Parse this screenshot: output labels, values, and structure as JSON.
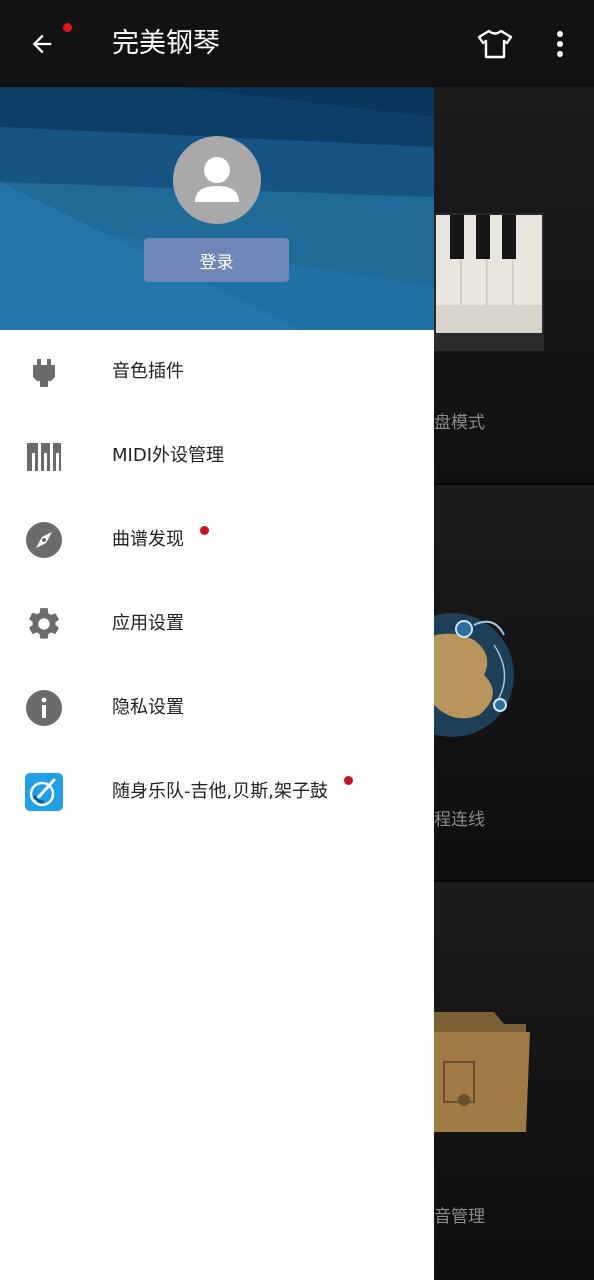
{
  "appbar": {
    "title": "完美钢琴",
    "back_icon": "arrow-left-icon",
    "skin_icon": "t-shirt-icon",
    "more_icon": "more-vertical-icon",
    "notification_dot_color": "#e5141f"
  },
  "drawer": {
    "header_color": "#1f6a98",
    "avatar_icon": "user-avatar-icon",
    "login_label": "登录",
    "items": [
      {
        "label": "音色插件",
        "icon": "plugin-icon",
        "has_dot": false
      },
      {
        "label": "MIDI外设管理",
        "icon": "midi-keyboard-icon",
        "has_dot": false
      },
      {
        "label": "曲谱发现",
        "icon": "compass-icon",
        "has_dot": true
      },
      {
        "label": "应用设置",
        "icon": "gear-icon",
        "has_dot": false
      },
      {
        "label": "隐私设置",
        "icon": "info-icon",
        "has_dot": false
      },
      {
        "label": "随身乐队-吉他,贝斯,架子鼓",
        "icon": "band-app-icon",
        "has_dot": true
      }
    ]
  },
  "background": {
    "panels": [
      {
        "label": "盘模式",
        "art": "piano-keys-image"
      },
      {
        "label": "程连线",
        "art": "globe-image"
      },
      {
        "label": "音管理",
        "art": "music-folder-image"
      }
    ]
  },
  "colors": {
    "accent_dot": "#cc1020",
    "login_button": "#6f86b8",
    "menu_icon": "#6b6b6b"
  }
}
